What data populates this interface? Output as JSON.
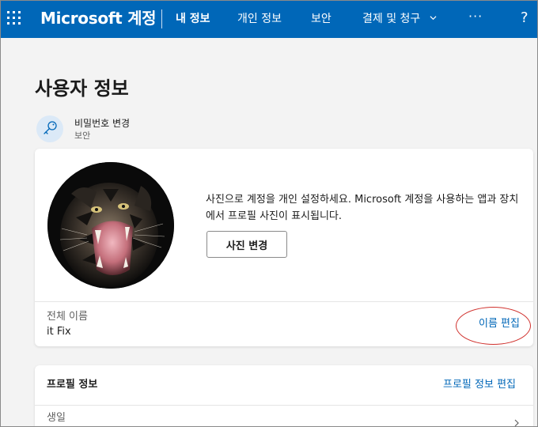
{
  "nav": {
    "brand": "Microsoft 계정",
    "items": [
      {
        "label": "내 정보",
        "active": true
      },
      {
        "label": "개인 정보",
        "active": false
      },
      {
        "label": "보안",
        "active": false
      },
      {
        "label": "결제 및 청구",
        "active": false
      }
    ],
    "more": "···",
    "help": "?",
    "icons": {
      "apps": "waffle-icon",
      "dropdown": "chevron-down-icon"
    },
    "colors": {
      "bar": "#0067b8",
      "text": "#ffffff"
    }
  },
  "page": {
    "title": "사용자 정보"
  },
  "password": {
    "title": "비밀번호 변경",
    "subtitle": "보안",
    "icon": "key-icon"
  },
  "photo_card": {
    "description": "사진으로 계정을 개인 설정하세요. Microsoft 계정을 사용하는 앱과 장치에서 프로필 사진이 표시됩니다.",
    "change_button": "사진 변경",
    "avatar": "tiger-avatar",
    "full_name_label": "전체 이름",
    "full_name_value": "it Fix",
    "edit_name_link": "이름 편집",
    "annotation_color": "#d0312d"
  },
  "profile_card": {
    "title": "프로필 정보",
    "edit_link": "프로필 정보 편집",
    "rows": [
      {
        "label": "생일"
      }
    ]
  },
  "colors": {
    "link": "#0067b8",
    "background": "#f3f3f3",
    "card": "#ffffff"
  }
}
